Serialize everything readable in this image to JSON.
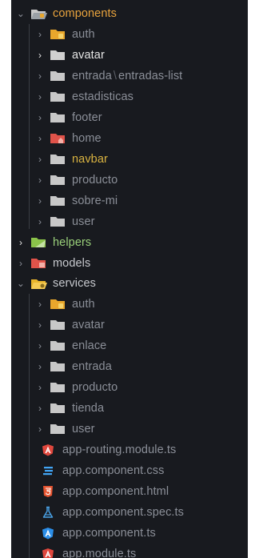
{
  "explorer": {
    "colors": {
      "background": "#181a1f",
      "text_dim": "#8b8f98",
      "text_bright": "#e6e6e6",
      "components_label": "#e8a33d",
      "navbar_label": "#d9b341",
      "helpers_label": "#9ad07a",
      "folder_default": "#c8c8c8",
      "folder_auth": "#e9a72c",
      "folder_home": "#e0534a",
      "folder_helpers": "#8bc34a",
      "folder_models": "#e0534a",
      "folder_services": "#e9b52c"
    },
    "components": {
      "label": "components",
      "icon": "components-folder-open-icon",
      "children": [
        {
          "label": "auth",
          "icon": "folder-auth-icon"
        },
        {
          "label": "avatar",
          "icon": "folder-icon"
        },
        {
          "label_a": "entrada",
          "sep": "\\",
          "label_b": "entradas-list",
          "icon": "folder-icon"
        },
        {
          "label": "estadisticas",
          "icon": "folder-icon"
        },
        {
          "label": "footer",
          "icon": "folder-icon"
        },
        {
          "label": "home",
          "icon": "folder-home-icon"
        },
        {
          "label": "navbar",
          "icon": "folder-icon"
        },
        {
          "label": "producto",
          "icon": "folder-icon"
        },
        {
          "label": "sobre-mi",
          "icon": "folder-icon"
        },
        {
          "label": "user",
          "icon": "folder-icon"
        }
      ]
    },
    "helpers": {
      "label": "helpers",
      "icon": "folder-helpers-icon"
    },
    "models": {
      "label": "models",
      "icon": "folder-models-icon"
    },
    "services": {
      "label": "services",
      "icon": "services-folder-open-icon",
      "children": [
        {
          "label": "auth",
          "icon": "folder-auth-icon"
        },
        {
          "label": "avatar",
          "icon": "folder-icon"
        },
        {
          "label": "enlace",
          "icon": "folder-icon"
        },
        {
          "label": "entrada",
          "icon": "folder-icon"
        },
        {
          "label": "producto",
          "icon": "folder-icon"
        },
        {
          "label": "tienda",
          "icon": "folder-icon"
        },
        {
          "label": "user",
          "icon": "folder-icon"
        }
      ]
    },
    "files": [
      {
        "label": "app-routing.module.ts",
        "icon": "angular-icon"
      },
      {
        "label": "app.component.css",
        "icon": "css-icon"
      },
      {
        "label": "app.component.html",
        "icon": "html-icon"
      },
      {
        "label": "app.component.spec.ts",
        "icon": "test-flask-icon"
      },
      {
        "label": "app.component.ts",
        "icon": "angular-component-icon"
      },
      {
        "label": "app.module.ts",
        "icon": "angular-icon"
      }
    ]
  }
}
